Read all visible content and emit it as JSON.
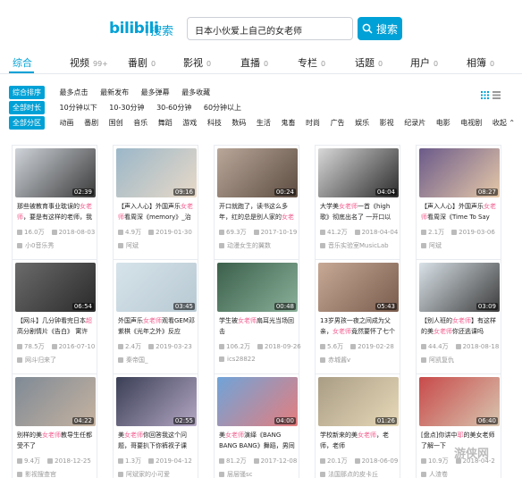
{
  "header": {
    "logo_text": "bilibili",
    "logo_sub": "搜索",
    "search_value": "日本小伙爱上自己的女老师",
    "search_button": "搜索",
    "brand_color": "#00a1d6"
  },
  "tabs": [
    {
      "label": "综合",
      "count": "",
      "active": true
    },
    {
      "label": "视频",
      "count": "99+"
    },
    {
      "label": "番剧",
      "count": "0"
    },
    {
      "label": "影视",
      "count": "0"
    },
    {
      "label": "直播",
      "count": "0"
    },
    {
      "label": "专栏",
      "count": "0"
    },
    {
      "label": "话题",
      "count": "0"
    },
    {
      "label": "用户",
      "count": "0"
    },
    {
      "label": "相簿",
      "count": "0"
    }
  ],
  "filters": {
    "sort": {
      "head": "综合排序",
      "options": [
        "最多点击",
        "最新发布",
        "最多弹幕",
        "最多收藏"
      ]
    },
    "duration": {
      "head": "全部时长",
      "options": [
        "10分钟以下",
        "10-30分钟",
        "30-60分钟",
        "60分钟以上"
      ]
    },
    "zone": {
      "head": "全部分区",
      "options": [
        "动画",
        "番剧",
        "国创",
        "音乐",
        "舞蹈",
        "游戏",
        "科技",
        "数码",
        "生活",
        "鬼畜",
        "时尚",
        "广告",
        "娱乐",
        "影视",
        "纪录片",
        "电影",
        "电视剧"
      ],
      "fold": "收起"
    }
  },
  "cards": [
    {
      "duration": "02:39",
      "title_pre": "那些被教育事业耽误的",
      "title_hl": "女老师",
      "title_post": "，要是有这样的老师，我",
      "views": "16.0万",
      "date": "2018-08-03",
      "uploader": "小0音乐秀"
    },
    {
      "duration": "09:16",
      "title_pre": "【声入人心】外国声乐",
      "title_hl": "女老师",
      "title_post": "看周深《memory》_治愈",
      "views": "4.9万",
      "date": "2019-01-30",
      "uploader": "阿斌"
    },
    {
      "duration": "00:24",
      "title_pre": "开口就跑了，读书这么多年，红的总是别人家的",
      "title_hl": "女老",
      "title_post": "",
      "views": "69.3万",
      "date": "2017-10-19",
      "uploader": "动漫女生的翼数"
    },
    {
      "duration": "04:04",
      "title_pre": "大学美",
      "title_hl": "女老师",
      "title_post": "一首《high歌》彻底出名了 一开口以为",
      "views": "41.2万",
      "date": "2018-04-04",
      "uploader": "音乐实验室MusicLab"
    },
    {
      "duration": "08:27",
      "title_pre": "【声入人心】外国声乐",
      "title_hl": "女老师",
      "title_post": "看周深《Time To Say",
      "views": "2.1万",
      "date": "2019-03-06",
      "uploader": "阿斌"
    },
    {
      "duration": "06:54",
      "title_pre": "【网斗】几分钟看完日本",
      "title_hl": "超",
      "title_post": "高分剧情片《告白》 寓许女",
      "views": "78.5万",
      "date": "2016-07-10",
      "uploader": "网斗归来了"
    },
    {
      "duration": "03:45",
      "title_pre": "外国声乐",
      "title_hl": "女老师",
      "title_post": "观看GEM邓紫棋《光年之外》反应",
      "views": "2.4万",
      "date": "2019-03-23",
      "uploader": "秦帝国_"
    },
    {
      "duration": "00:48",
      "title_pre": "学生被",
      "title_hl": "女老师",
      "title_post": "扇耳光当场回击",
      "views": "106.2万",
      "date": "2018-09-26",
      "uploader": "ics28822"
    },
    {
      "duration": "05:43",
      "title_pre": "13岁男孩一夜之间成为父亲，",
      "title_hl": "女老师",
      "title_post": "竟然要怀了七个肚子哦",
      "views": "5.6万",
      "date": "2019-02-28",
      "uploader": "赤城酱v"
    },
    {
      "duration": "03:09",
      "title_pre": "【别人班的",
      "title_hl": "女老师",
      "title_post": "】有这样的美",
      "title_tail": "女老师",
      "title_after": "你还逃课吗",
      "views": "44.4万",
      "date": "2018-08-18",
      "uploader": "阿凯复仇"
    },
    {
      "duration": "04:22",
      "title_pre": "别样的美",
      "title_hl": "女老师",
      "title_post": "教导生任都受不了",
      "views": "9.4万",
      "date": "2018-12-25",
      "uploader": "影视搜查官"
    },
    {
      "duration": "02:55",
      "title_pre": "美",
      "title_hl": "女老师",
      "title_post": "你回答我这个问题，哥要扒下你裤衩子课",
      "views": "1.3万",
      "date": "2019-04-12",
      "uploader": "阿斌家的小可爱"
    },
    {
      "duration": "04:00",
      "title_pre": "美",
      "title_hl": "女老师",
      "title_post": "演绎《BANG BANG BANG》舞蹈，男同学乱入",
      "views": "81.2万",
      "date": "2017-12-08",
      "uploader": "层层骚sc"
    },
    {
      "duration": "01:26",
      "title_pre": "学校新来的美",
      "title_hl": "女老师",
      "title_post": "，老师，老师",
      "views": "20.1万",
      "date": "2018-06-09",
      "uploader": "法国那点的皮卡丘"
    },
    {
      "duration": "06:40",
      "title_pre": "[盘点]你讲中",
      "title_hl": "耶",
      "title_post": "的美女老师了解一下",
      "views": "10.9万",
      "date": "2018-04-2",
      "uploader": "人渣卷"
    }
  ],
  "watermark": "游侠网"
}
